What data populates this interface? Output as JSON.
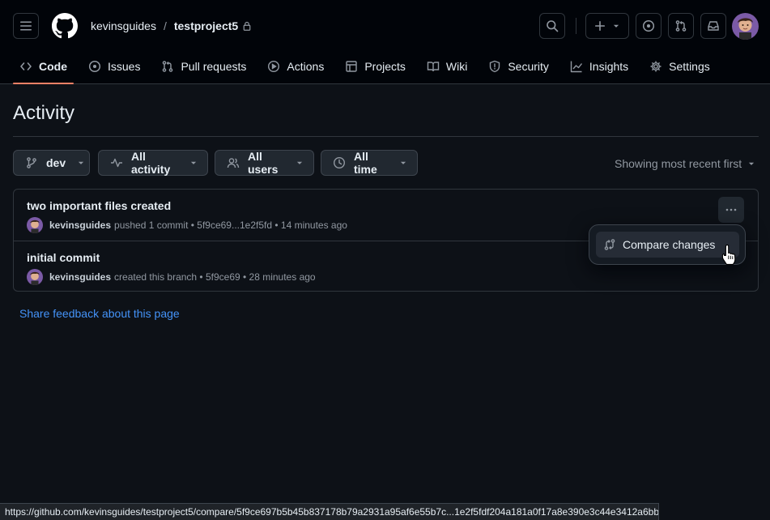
{
  "header": {
    "owner": "kevinsguides",
    "separator": "/",
    "repo": "testproject5",
    "icons": [
      "menu-icon",
      "github-logo-icon",
      "lock-icon",
      "search-icon",
      "plus-icon",
      "issue-icon",
      "pull-request-icon",
      "inbox-icon"
    ]
  },
  "tabs": [
    {
      "label": "Code",
      "icon": "code-icon",
      "selected": true
    },
    {
      "label": "Issues",
      "icon": "issue-icon"
    },
    {
      "label": "Pull requests",
      "icon": "pull-request-icon"
    },
    {
      "label": "Actions",
      "icon": "play-icon"
    },
    {
      "label": "Projects",
      "icon": "table-icon"
    },
    {
      "label": "Wiki",
      "icon": "book-icon"
    },
    {
      "label": "Security",
      "icon": "shield-icon"
    },
    {
      "label": "Insights",
      "icon": "graph-icon"
    },
    {
      "label": "Settings",
      "icon": "gear-icon"
    }
  ],
  "page": {
    "title": "Activity",
    "filters": {
      "branch": "dev",
      "activity": "All activity",
      "users": "All users",
      "time": "All time"
    },
    "sort_label": "Showing most recent first"
  },
  "activity": [
    {
      "title": "two important files created",
      "user": "kevinsguides",
      "detail": "pushed 1 commit • 5f9ce69...1e2f5fd • 14 minutes ago"
    },
    {
      "title": "initial commit",
      "user": "kevinsguides",
      "detail": "created this branch • 5f9ce69 • 28 minutes ago"
    }
  ],
  "menu": {
    "compare_label": "Compare changes"
  },
  "feedback_link": "Share feedback about this page",
  "status_url": "https://github.com/kevinsguides/testproject5/compare/5f9ce697b5b45b837178b79a2931a95af6e55b7c...1e2f5fdf204a181a0f17a8e390e3c44e3412a6bb",
  "colors": {
    "background": "#0d1117",
    "header": "#010409",
    "accent_tab": "#f78166",
    "link": "#4493f8",
    "border": "#30363d"
  }
}
